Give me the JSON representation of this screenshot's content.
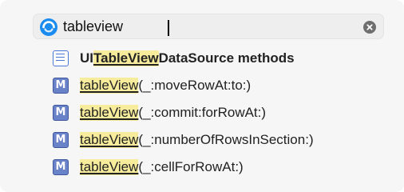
{
  "search": {
    "query": "tableview",
    "logo_icon": "xcode-quick-open-icon",
    "clear_icon": "clear-circle-x-icon"
  },
  "results": [
    {
      "kind": "document",
      "icon": "document-list-icon",
      "prefix": "UI",
      "match": "TableView",
      "suffix": "DataSource methods",
      "bold": true
    },
    {
      "kind": "method",
      "icon": "method-M-icon",
      "icon_letter": "M",
      "prefix": "",
      "match": "tableView",
      "suffix": "(_:moveRowAt:to:)",
      "bold": false
    },
    {
      "kind": "method",
      "icon": "method-M-icon",
      "icon_letter": "M",
      "prefix": "",
      "match": "tableView",
      "suffix": "(_:commit:forRowAt:)",
      "bold": false
    },
    {
      "kind": "method",
      "icon": "method-M-icon",
      "icon_letter": "M",
      "prefix": "",
      "match": "tableView",
      "suffix": "(_:numberOfRowsInSection:)",
      "bold": false
    },
    {
      "kind": "method",
      "icon": "method-M-icon",
      "icon_letter": "M",
      "prefix": "",
      "match": "tableView",
      "suffix": "(_:cellForRowAt:)",
      "bold": false
    }
  ],
  "colors": {
    "match_highlight": "#f7ec9c",
    "method_icon_fill": "#6a82c8",
    "logo_blue": "#1a8cf0"
  }
}
